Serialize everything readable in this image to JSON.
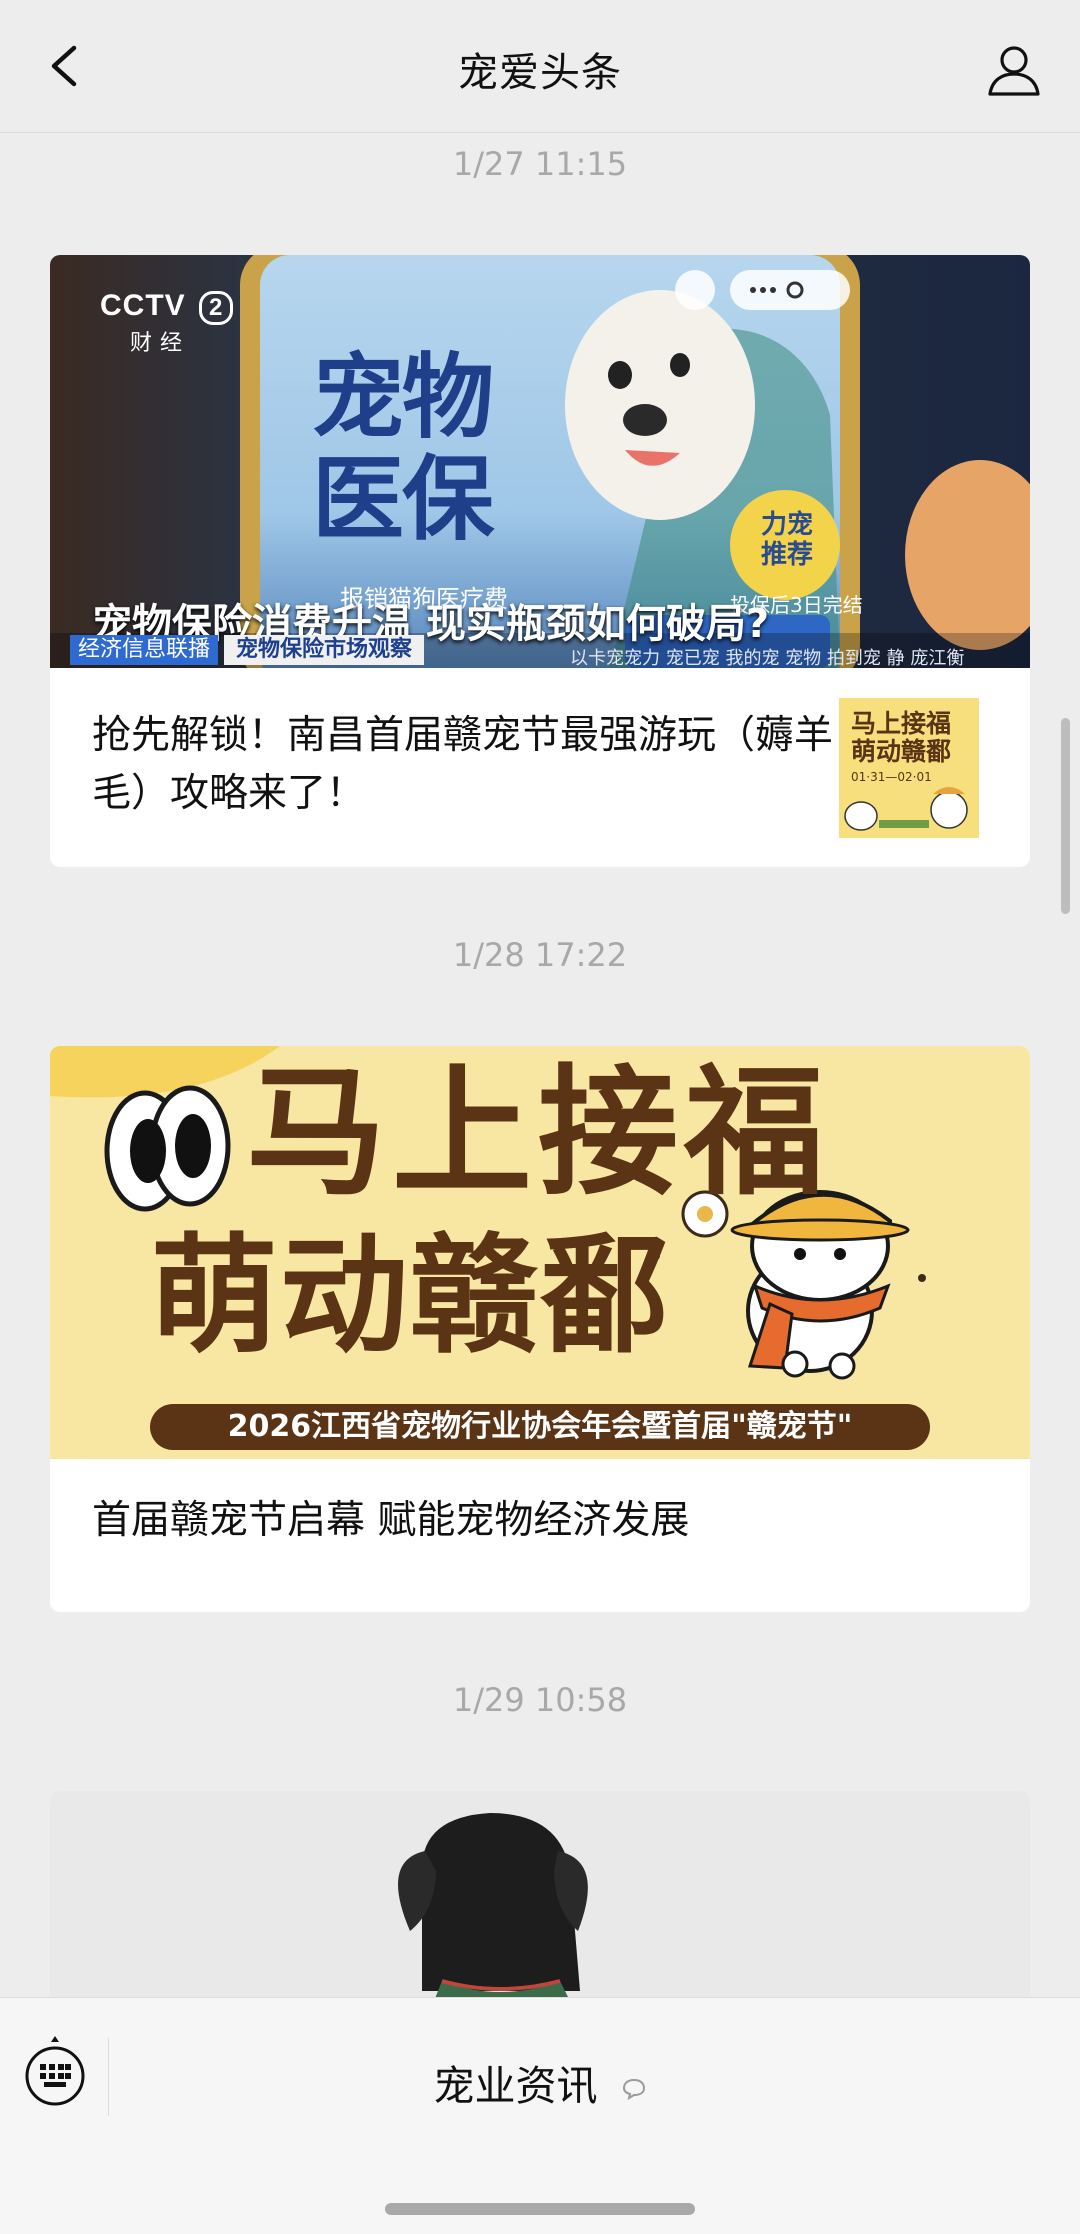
{
  "nav": {
    "title": "宠爱头条",
    "back_icon": "chevron-left-icon",
    "user_icon": "user-icon"
  },
  "feed": [
    {
      "time": "1/27 11:15",
      "cover": {
        "logo_text": "CCTV",
        "logo_num": "2",
        "logo_sub": "财经",
        "phone_big": [
          "宠物",
          "医保"
        ],
        "badge": [
          "力宠",
          "推荐"
        ],
        "headline": "宠物保险消费升温 现实瓶颈如何破局?",
        "ticker_left": "经济信息联播",
        "ticker_right": "宠物保险市场观察",
        "phone_strip": "报销猫狗医疗费",
        "phone_note": "投保后3日完结",
        "footer_text": "以卡宠宠力 宠已宠  我的宠  宠物  拍到宠  静  庞江衡"
      },
      "title": "抢先解锁！南昌首届赣宠节最强游玩（薅羊毛）攻略来了！",
      "thumb": {
        "line1": "马上接福",
        "line2": "萌动赣鄱",
        "dates": "01·31—02·01"
      }
    },
    {
      "time": "1/28 17:22",
      "cover": {
        "line1": "马上接福",
        "line2": "萌动赣鄱",
        "banner": "2026江西省宠物行业协会年会暨首届\"赣宠节\""
      },
      "title": "首届赣宠节启幕 赋能宠物经济发展"
    },
    {
      "time": "1/29 10:58"
    }
  ],
  "bottom": {
    "menu_label": "宠业资讯",
    "keyboard_icon": "keyboard-icon",
    "menu_icon": "chat-bubble-icon"
  },
  "colors": {
    "bg": "#ededed",
    "card": "#ffffff",
    "timestamp": "#a8a8a8",
    "poster_yellow": "#f8e7a3",
    "poster_brown": "#5b3416"
  }
}
